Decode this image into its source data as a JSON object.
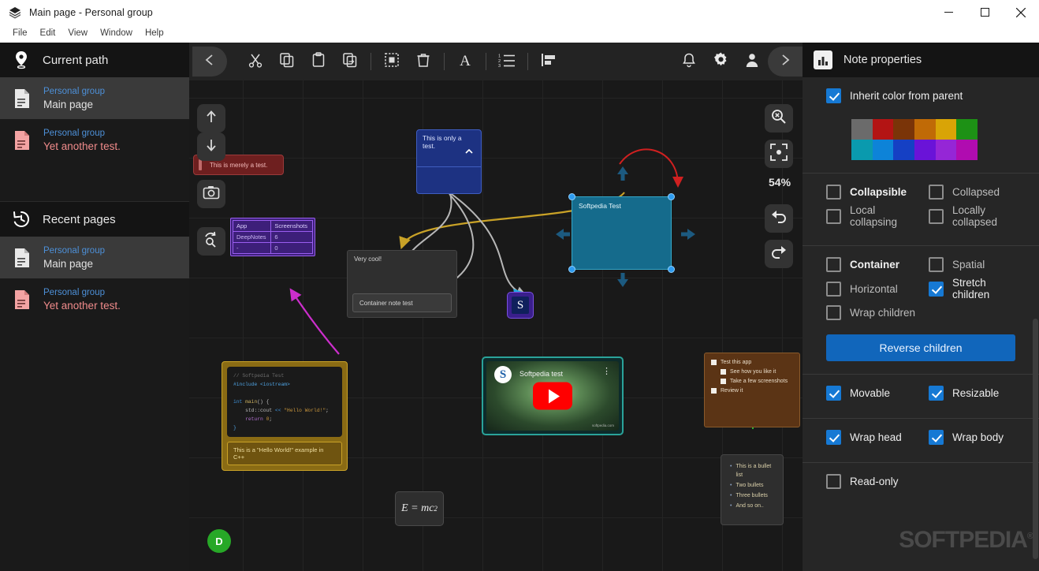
{
  "window": {
    "title": "Main page - Personal group",
    "app_icon": "deepnotes-icon",
    "minimize": "minimize-icon",
    "maximize": "maximize-icon",
    "close": "close-icon"
  },
  "menubar": {
    "items": [
      "File",
      "Edit",
      "View",
      "Window",
      "Help"
    ]
  },
  "sidebar": {
    "current_path": {
      "icon": "location-pin-icon",
      "label": "Current path"
    },
    "current_items": [
      {
        "group": "Personal group",
        "page": "Main page",
        "icon": "document-icon",
        "active": true
      },
      {
        "group": "Personal group",
        "page": "Yet another test.",
        "icon": "document-red-icon",
        "active": false
      }
    ],
    "recent_pages": {
      "icon": "history-clock-icon",
      "label": "Recent pages"
    },
    "recent_items": [
      {
        "group": "Personal group",
        "page": "Main page",
        "icon": "document-icon",
        "active": true
      },
      {
        "group": "Personal group",
        "page": "Yet another test.",
        "icon": "document-red-icon",
        "active": false
      }
    ]
  },
  "toolbar": {
    "back": "chevron-left-icon",
    "forward": "chevron-right-icon",
    "tools": [
      {
        "name": "cut-icon",
        "label": "Cut"
      },
      {
        "name": "copy-icon",
        "label": "Copy"
      },
      {
        "name": "paste-icon",
        "label": "Paste"
      },
      {
        "name": "duplicate-icon",
        "label": "Duplicate"
      },
      {
        "name": "select-all-icon",
        "label": "Select all"
      },
      {
        "name": "delete-icon",
        "label": "Delete"
      },
      {
        "name": "text-format-icon",
        "label": "Text"
      },
      {
        "name": "numbered-list-icon",
        "label": "Numbered list"
      },
      {
        "name": "align-left-icon",
        "label": "Align"
      }
    ],
    "right_tools": [
      {
        "name": "bell-icon",
        "label": "Notifications"
      },
      {
        "name": "gear-icon",
        "label": "Settings"
      },
      {
        "name": "person-icon",
        "label": "Account"
      }
    ]
  },
  "canvas": {
    "left_tools": [
      {
        "name": "arrow-up-icon",
        "label": "Move up"
      },
      {
        "name": "arrow-down-icon",
        "label": "Move down"
      },
      {
        "name": "camera-icon",
        "label": "Screenshot"
      },
      {
        "name": "sync-search-icon",
        "label": "Sync"
      }
    ],
    "right_tools": [
      {
        "name": "zoom-reset-icon",
        "label": "Reset zoom"
      },
      {
        "name": "fit-to-screen-icon",
        "label": "Fit to screen"
      },
      {
        "name": "undo-icon",
        "label": "Undo"
      },
      {
        "name": "redo-icon",
        "label": "Redo"
      }
    ],
    "zoom_level": "54%",
    "notes": {
      "blue_note": {
        "text": "This is only a test.",
        "collapse_icon": "chevron-up-icon"
      },
      "red_tooltip": {
        "text": "This is merely a test."
      },
      "table_note": {
        "headers": [
          "App",
          "Screenshots"
        ],
        "rows": [
          [
            "DeepNotes",
            "6"
          ],
          [
            "-",
            "0"
          ]
        ]
      },
      "container_note": {
        "title": "Very cool!",
        "child": "Container note test"
      },
      "teal_note": {
        "title": "Softpedia Test",
        "selected": true
      },
      "s_note": {
        "letter": "S"
      },
      "code_note": {
        "lines": [
          "// Softpedia Test",
          "#include <iostream>",
          "",
          "int main() {",
          "    std::cout << \"Hello World!\";",
          "    return 0;",
          "}"
        ],
        "caption": "This is a \"Hello World!\" example in C++"
      },
      "video_note": {
        "title": "Softpedia test",
        "play_icon": "play-button-icon",
        "watermark": "softpedia.com"
      },
      "checklist_note": {
        "items": [
          {
            "text": "Test this app",
            "indent": 0
          },
          {
            "text": "See how you like it",
            "indent": 1
          },
          {
            "text": "Take a few screenshots",
            "indent": 1
          },
          {
            "text": "Review it",
            "indent": 0
          }
        ]
      },
      "bullet_note": {
        "items": [
          "This is a bullet list",
          "Two bullets",
          "Three bullets",
          "And so on.."
        ]
      },
      "math_note": {
        "formula": "E = mc",
        "exponent": "2"
      },
      "avatar": {
        "letter": "D",
        "color": "#27a827"
      }
    }
  },
  "properties_panel": {
    "header": {
      "icon": "chart-properties-icon",
      "title": "Note properties"
    },
    "inherit_color": {
      "label": "Inherit color from parent",
      "checked": true
    },
    "palette": [
      "#6b6b6b",
      "#b31414",
      "#7a3408",
      "#c06a06",
      "#d9a406",
      "#1d9115",
      "#0a9aae",
      "#0d83d8",
      "#1540c4",
      "#6a13d8",
      "#9526d6",
      "#b00cb0"
    ],
    "groups": [
      {
        "rows": [
          [
            {
              "label": "Collapsible",
              "checked": false,
              "emphasis": "strong"
            },
            {
              "label": "Collapsed",
              "checked": false,
              "emphasis": "normal"
            }
          ],
          [
            {
              "label": "Local collapsing",
              "checked": false,
              "emphasis": "normal"
            },
            {
              "label": "Locally collapsed",
              "checked": false,
              "emphasis": "normal"
            }
          ]
        ]
      },
      {
        "rows": [
          [
            {
              "label": "Container",
              "checked": false,
              "emphasis": "strong"
            },
            {
              "label": "Spatial",
              "checked": false,
              "emphasis": "normal"
            }
          ],
          [
            {
              "label": "Horizontal",
              "checked": false,
              "emphasis": "normal"
            },
            {
              "label": "Stretch children",
              "checked": true,
              "emphasis": "bright"
            }
          ],
          [
            {
              "label": "Wrap children",
              "checked": false,
              "emphasis": "normal"
            }
          ]
        ],
        "button": "Reverse children"
      },
      {
        "rows": [
          [
            {
              "label": "Movable",
              "checked": true,
              "emphasis": "bright"
            },
            {
              "label": "Resizable",
              "checked": true,
              "emphasis": "bright"
            }
          ]
        ]
      },
      {
        "rows": [
          [
            {
              "label": "Wrap head",
              "checked": true,
              "emphasis": "bright"
            },
            {
              "label": "Wrap body",
              "checked": true,
              "emphasis": "bright"
            }
          ]
        ]
      },
      {
        "rows": [
          [
            {
              "label": "Read-only",
              "checked": false,
              "emphasis": "bright"
            }
          ]
        ]
      }
    ]
  },
  "watermark": {
    "text": "SOFTPEDIA",
    "mark": "®"
  }
}
